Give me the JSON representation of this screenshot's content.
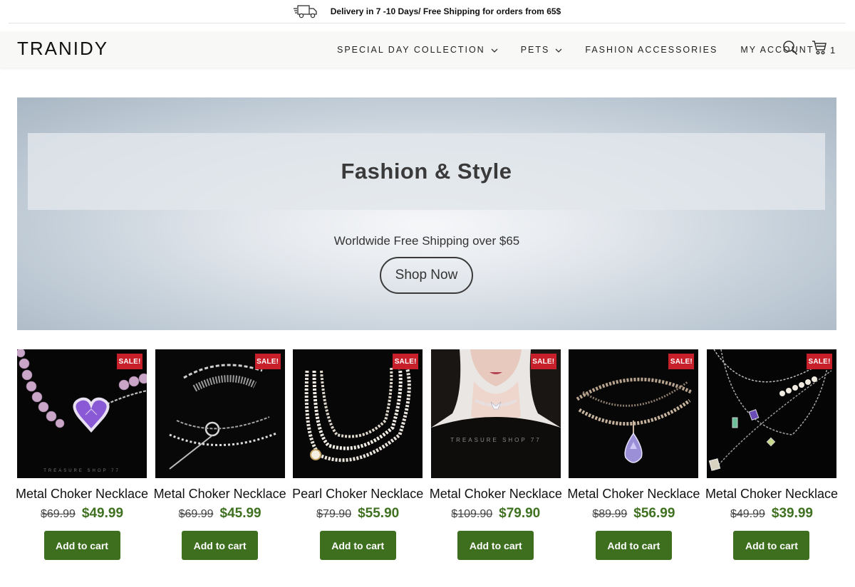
{
  "announcement": {
    "icon": "delivery-truck-icon",
    "text": "Delivery in 7 -10 Days/ Free Shipping for orders from 65$"
  },
  "header": {
    "logo": "TRANIDY",
    "nav": [
      {
        "label": "SPECIAL DAY COLLECTION",
        "has_dropdown": true
      },
      {
        "label": "PETS",
        "has_dropdown": true
      },
      {
        "label": "FASHION ACCESSORIES",
        "has_dropdown": false
      },
      {
        "label": "MY ACCOUNT",
        "has_dropdown": false
      }
    ],
    "cart_count": "1"
  },
  "hero": {
    "title": "Fashion & Style",
    "subtitle": "Worldwide Free Shipping over $65",
    "button": "Shop Now"
  },
  "products": [
    {
      "title": "Metal Choker Necklace",
      "old_price": "$69.99",
      "price": "$49.99",
      "badge": "SALE!",
      "button": "Add to cart"
    },
    {
      "title": "Metal Choker Necklace",
      "old_price": "$69.99",
      "price": "$45.99",
      "badge": "SALE!",
      "button": "Add to cart"
    },
    {
      "title": "Pearl Choker Necklace",
      "old_price": "$79.90",
      "price": "$55.90",
      "badge": "SALE!",
      "button": "Add to cart"
    },
    {
      "title": "Metal Choker Necklace",
      "old_price": "$109.90",
      "price": "$79.90",
      "badge": "SALE!",
      "button": "Add to cart"
    },
    {
      "title": "Metal Choker Necklace",
      "old_price": "$89.99",
      "price": "$56.99",
      "badge": "SALE!",
      "button": "Add to cart"
    },
    {
      "title": "Metal Choker Necklace",
      "old_price": "$49.99",
      "price": "$39.99",
      "badge": "SALE!",
      "button": "Add to cart"
    }
  ],
  "colors": {
    "sale_badge": "#c8202a",
    "price_green": "#3f7120",
    "cart_button": "#3e6f1f"
  }
}
